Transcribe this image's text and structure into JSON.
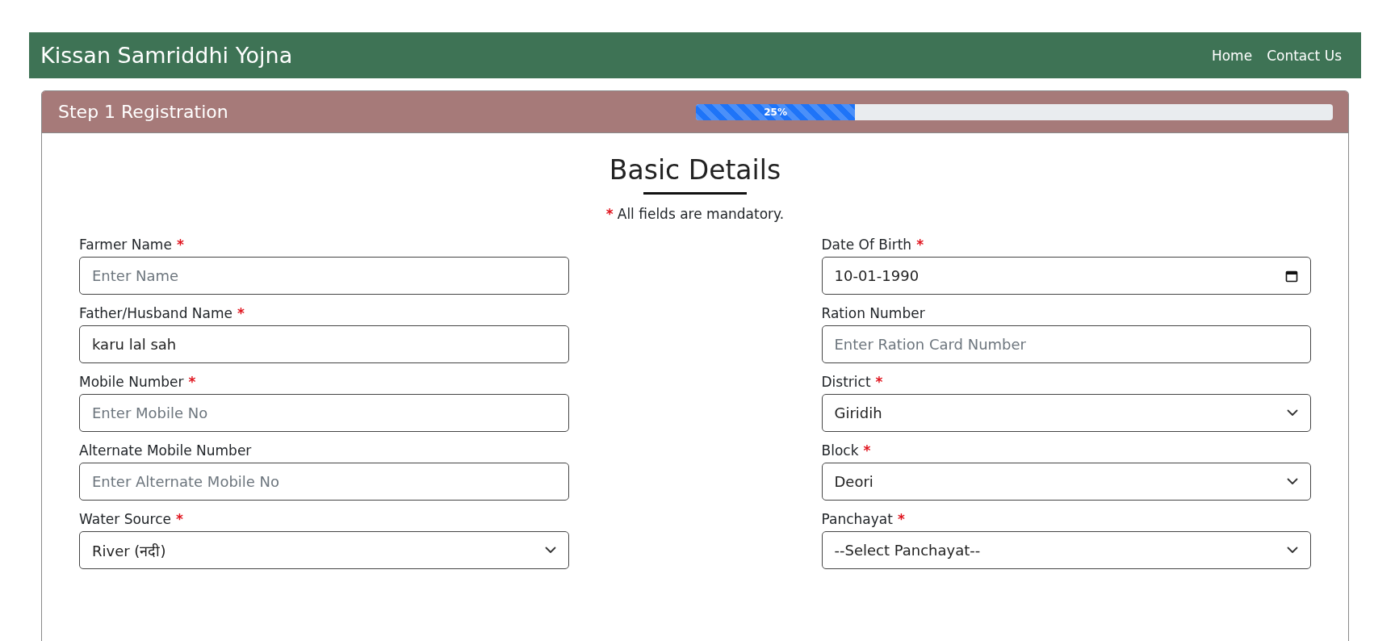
{
  "navbar": {
    "brand": "Kissan Samriddhi Yojna",
    "links": [
      "Home",
      "Contact Us"
    ]
  },
  "card": {
    "title": "Step 1 Registration",
    "progress": {
      "level": 0.25,
      "label": "25%"
    }
  },
  "section": {
    "heading": "Basic Details",
    "notice": {
      "mark": "*",
      "text": "All fields are mandatory."
    }
  },
  "fields": [
    {
      "label": "Farmer Name",
      "mark": "*",
      "kind": "input",
      "placeholder": "Enter Name"
    },
    {
      "label": "Date Of Birth",
      "mark": "*",
      "kind": "date",
      "value": "10-01-1990"
    },
    {
      "label": "Father/Husband Name",
      "mark": "*",
      "kind": "input",
      "value": "karu lal sah"
    },
    {
      "label": "Ration Number",
      "kind": "input",
      "placeholder": "Enter Ration Card Number"
    },
    {
      "label": "Mobile Number",
      "mark": "*",
      "kind": "input",
      "placeholder": "Enter Mobile No"
    },
    {
      "label": "District",
      "mark": "*",
      "kind": "select",
      "value": "Giridih"
    },
    {
      "label": "Alternate Mobile Number",
      "kind": "input",
      "placeholder": "Enter Alternate Mobile No"
    },
    {
      "label": "Block",
      "mark": "*",
      "kind": "select",
      "value": "Deori"
    },
    {
      "label": "Water Source",
      "mark": "*",
      "kind": "select",
      "value": "River (नदी)"
    },
    {
      "label": "Panchayat",
      "mark": "*",
      "kind": "select",
      "value": "--Select Panchayat--"
    }
  ]
}
